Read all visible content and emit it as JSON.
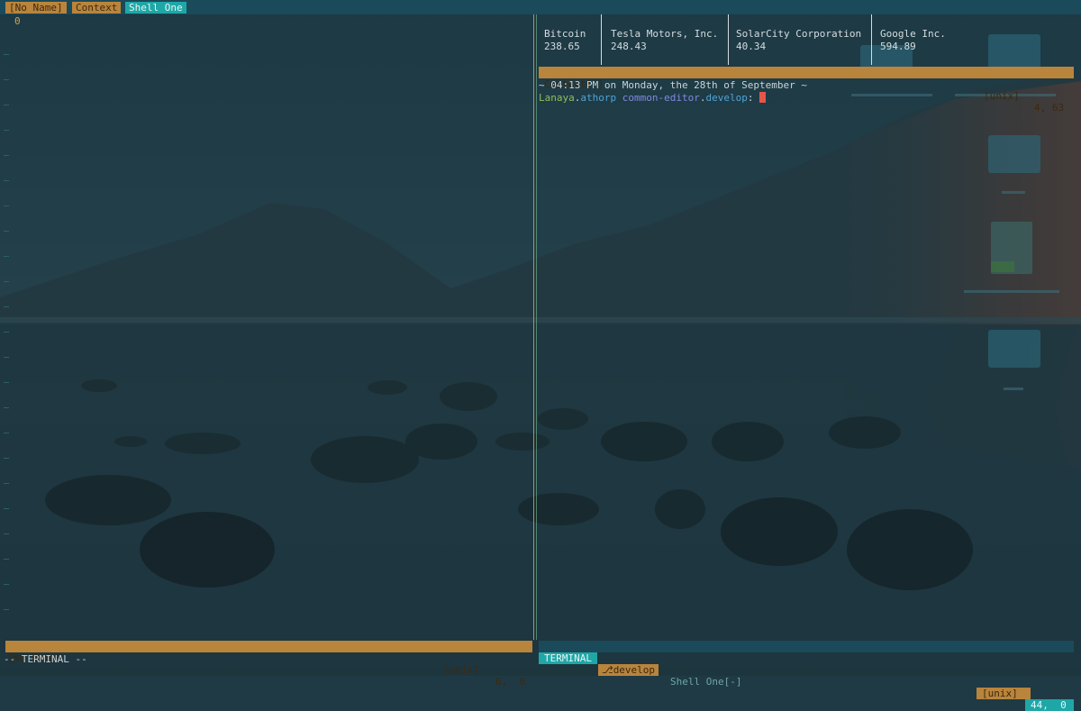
{
  "tabline": {
    "tabs": [
      {
        "label": "[No Name]",
        "state": "inactive"
      },
      {
        "label": "Context",
        "state": "inactive"
      },
      {
        "label": "Shell One",
        "state": "active"
      }
    ]
  },
  "left_pane": {
    "line_number": "0"
  },
  "ticker": {
    "columns": [
      {
        "name": "Bitcoin",
        "price": "238.65"
      },
      {
        "name": "Tesla Motors, Inc.",
        "price": "248.43"
      },
      {
        "name": "SolarCity Corporation",
        "price": "40.34"
      },
      {
        "name": "Google Inc.",
        "price": "594.89"
      }
    ]
  },
  "context_status": {
    "name": "Context[-]",
    "format": "[unix]",
    "position": "4, 63"
  },
  "terminal": {
    "clock_line": "~ 04:13 PM on Monday, the 28th of September ~",
    "prompt": {
      "user": "Lanaya",
      "sep1": ".",
      "host": "athorp",
      "sep2": " ",
      "dir": "common-editor",
      "sep3": ".",
      "branch": "develop",
      "suffix": ": "
    }
  },
  "left_status": {
    "name": "[No Name]",
    "format": "[unix]",
    "position": "0,  0"
  },
  "right_status": {
    "mode": "TERMINAL",
    "branch": "develop",
    "branch_icon": "git-branch-icon",
    "name": "Shell One[-]",
    "format": "[unix]",
    "position": "44,  0"
  },
  "cmdline": {
    "text": "-- TERMINAL --"
  },
  "colors": {
    "accent_orange": "#b9843c",
    "accent_teal": "#1fa7a7",
    "bar_bg": "#1b4a5a",
    "cursor": "#e5564a"
  }
}
